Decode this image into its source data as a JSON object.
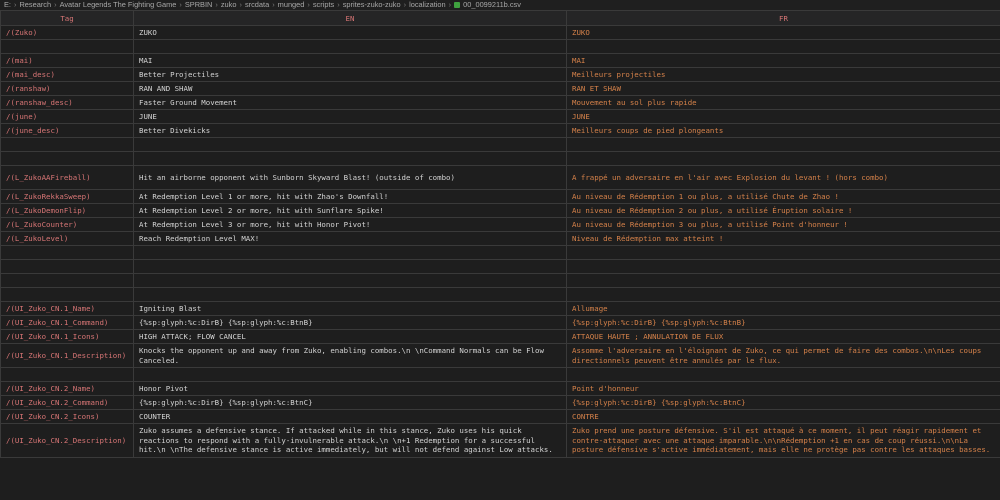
{
  "breadcrumb": {
    "items": [
      "E:",
      "Research",
      "Avatar Legends The Fighting Game",
      "SPRBIN",
      "zuko",
      "srcdata",
      "munged",
      "scripts",
      "sprites-zuko-zuko",
      "localization"
    ],
    "file": "00_0099211b.csv",
    "file_icon": "csv-file-icon",
    "separator": "›"
  },
  "table": {
    "headers": [
      "Tag",
      "EN",
      "FR"
    ],
    "rows": [
      {
        "tag": "/(Zuko)",
        "en": "ZUKO",
        "fr": "ZUKO",
        "h": 14
      },
      {
        "tag": "",
        "en": "",
        "fr": "",
        "h": 14
      },
      {
        "tag": "/(mai)",
        "en": "MAI",
        "fr": "MAI",
        "h": 14
      },
      {
        "tag": "/(mai_desc)",
        "en": "Better Projectiles",
        "fr": "Meilleurs projectiles",
        "h": 14
      },
      {
        "tag": "/(ranshaw)",
        "en": "RAN AND SHAW",
        "fr": "RAN ET SHAW",
        "h": 14
      },
      {
        "tag": "/(ranshaw_desc)",
        "en": "Faster Ground Movement",
        "fr": "Mouvement au sol plus rapide",
        "h": 14
      },
      {
        "tag": "/(june)",
        "en": "JUNE",
        "fr": "JUNE",
        "h": 14
      },
      {
        "tag": "/(june_desc)",
        "en": "Better Divekicks",
        "fr": "Meilleurs coups de pied plongeants",
        "h": 14
      },
      {
        "tag": "",
        "en": "",
        "fr": "",
        "h": 14
      },
      {
        "tag": "",
        "en": "",
        "fr": "",
        "h": 14
      },
      {
        "tag": "/(L_ZukoAAFireball)",
        "en": "Hit an airborne opponent with Sunborn Skyward Blast! (outside of combo)",
        "fr": "A frappé un adversaire en l'air avec Explosion du levant ! (hors combo)",
        "h": 24
      },
      {
        "tag": "/(L_ZukoRekkaSweep)",
        "en": "At Redemption Level 1 or more, hit with Zhao's Downfall!",
        "fr": "Au niveau de Rédemption 1 ou plus, a utilisé Chute de Zhao !",
        "h": 14
      },
      {
        "tag": "/(L_ZukoDemonFlip)",
        "en": "At Redemption Level 2 or more, hit with Sunflare Spike!",
        "fr": "Au niveau de Rédemption 2 ou plus, a utilisé Éruption solaire !",
        "h": 14
      },
      {
        "tag": "/(L_ZukoCounter)",
        "en": "At Redemption Level 3 or more, hit with Honor Pivot!",
        "fr": "Au niveau de Rédemption 3 ou plus, a utilisé Point d'honneur !",
        "h": 14
      },
      {
        "tag": "/(L_ZukoLevel)",
        "en": "Reach Redemption Level MAX!",
        "fr": "Niveau de Rédemption max atteint !",
        "h": 14
      },
      {
        "tag": "",
        "en": "",
        "fr": "",
        "h": 14
      },
      {
        "tag": "",
        "en": "",
        "fr": "",
        "h": 14
      },
      {
        "tag": "",
        "en": "",
        "fr": "",
        "h": 14
      },
      {
        "tag": "",
        "en": "",
        "fr": "",
        "h": 14
      },
      {
        "tag": "/(UI_Zuko_CN.1_Name)",
        "en": "Igniting Blast",
        "fr": "Allumage",
        "h": 14
      },
      {
        "tag": "/(UI_Zuko_CN.1_Command)",
        "en": "{%sp:glyph:%c:DirB} {%sp:glyph:%c:BtnB}",
        "fr": "{%sp:glyph:%c:DirB} {%sp:glyph:%c:BtnB}",
        "h": 14
      },
      {
        "tag": "/(UI_Zuko_CN.1_Icons)",
        "en": "HIGH ATTACK; FLOW CANCEL",
        "fr": "ATTAQUE HAUTE ; ANNULATION DE FLUX",
        "h": 14
      },
      {
        "tag": "/(UI_Zuko_CN.1_Description)",
        "en": "Knocks the opponent up and away from Zuko, enabling combos.\\n \\nCommand Normals can be Flow Canceled.",
        "fr": "Assomme l'adversaire en l'éloignant de Zuko, ce qui permet de faire des combos.\\n\\nLes coups directionnels peuvent être annulés par le flux.",
        "h": 24
      },
      {
        "tag": "",
        "en": "",
        "fr": "",
        "h": 14
      },
      {
        "tag": "/(UI_Zuko_CN.2_Name)",
        "en": "Honor Pivot",
        "fr": "Point d'honneur",
        "h": 14
      },
      {
        "tag": "/(UI_Zuko_CN.2_Command)",
        "en": "{%sp:glyph:%c:DirB} {%sp:glyph:%c:BtnC}",
        "fr": "{%sp:glyph:%c:DirB} {%sp:glyph:%c:BtnC}",
        "h": 14
      },
      {
        "tag": "/(UI_Zuko_CN.2_Icons)",
        "en": "COUNTER",
        "fr": "CONTRE",
        "h": 14
      },
      {
        "tag": "/(UI_Zuko_CN.2_Description)",
        "en": "Zuko assumes a defensive stance. If attacked while in this stance, Zuko uses his quick reactions to respond with a fully-invulnerable attack.\\n \\n+1 Redemption for a successful hit.\\n \\nThe defensive stance is active immediately, but will not defend against Low attacks.",
        "fr": "Zuko prend une posture défensive. S'il est attaqué à ce moment, il peut réagir rapidement et contre-attaquer avec une attaque imparable.\\n\\nRédemption +1 en cas de coup réussi.\\n\\nLa posture défensive s'active immédiatement, mais elle ne protège pas contre les attaques basses.",
        "h": 34
      }
    ]
  },
  "colors": {
    "background": "#1e1e1e",
    "grid": "#3a3a3a",
    "tag_text": "#d77575",
    "en_text": "#d4d4d4",
    "fr_text": "#d6824a",
    "csv_icon": "#3fa23f"
  }
}
